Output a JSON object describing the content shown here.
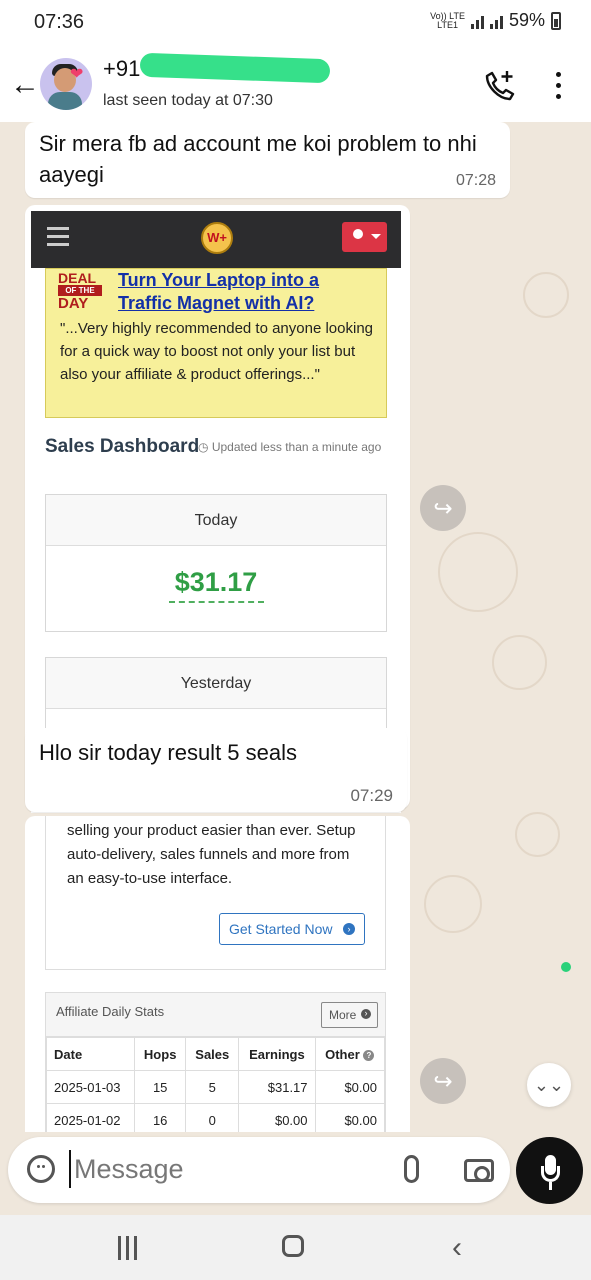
{
  "status_bar": {
    "time": "07:36",
    "network_top": "Vo)) LTE",
    "network_bottom": "LTE1",
    "battery": "59%"
  },
  "header": {
    "contact_prefix": "+91",
    "last_seen": "last seen today at 07:30"
  },
  "messages": {
    "incoming_text": "Sir mera fb ad account me koi problem to nhi aayegi",
    "incoming_time": "07:28",
    "reply_text": "Hlo sir today result  5 seals",
    "reply_time": "07:29"
  },
  "screenshot": {
    "logo": "W+",
    "deal_label_1": "DEAL",
    "deal_label_2": "OF THE",
    "deal_label_3": "DAY",
    "deal_title": "Turn Your Laptop into a Traffic Magnet with AI?",
    "deal_text": "\"...Very highly recommended to anyone looking for a quick way to boost not only your list but also your affiliate & product offerings...\"",
    "dashboard_title": "Sales Dashboard",
    "updated_text": "Updated less than a minute ago",
    "today_label": "Today",
    "today_value": "$31.17",
    "yesterday_label": "Yesterday",
    "feature_text": "selling your product easier than ever. Setup auto-delivery, sales funnels and more from an easy-to-use interface.",
    "get_started": "Get Started Now",
    "stats_label": "Affiliate Daily Stats",
    "more": "More",
    "table_headers": [
      "Date",
      "Hops",
      "Sales",
      "Earnings",
      "Other"
    ],
    "table_rows": [
      [
        "2025-01-03",
        "15",
        "5",
        "$31.17",
        "$0.00"
      ],
      [
        "2025-01-02",
        "16",
        "0",
        "$0.00",
        "$0.00"
      ]
    ]
  },
  "composer": {
    "placeholder": "Message"
  },
  "colors": {
    "chat_background": "#efe7dc",
    "accent_green": "#2f9e45",
    "whatsapp_mic": "#111111",
    "deal_background": "#f7f09a"
  }
}
